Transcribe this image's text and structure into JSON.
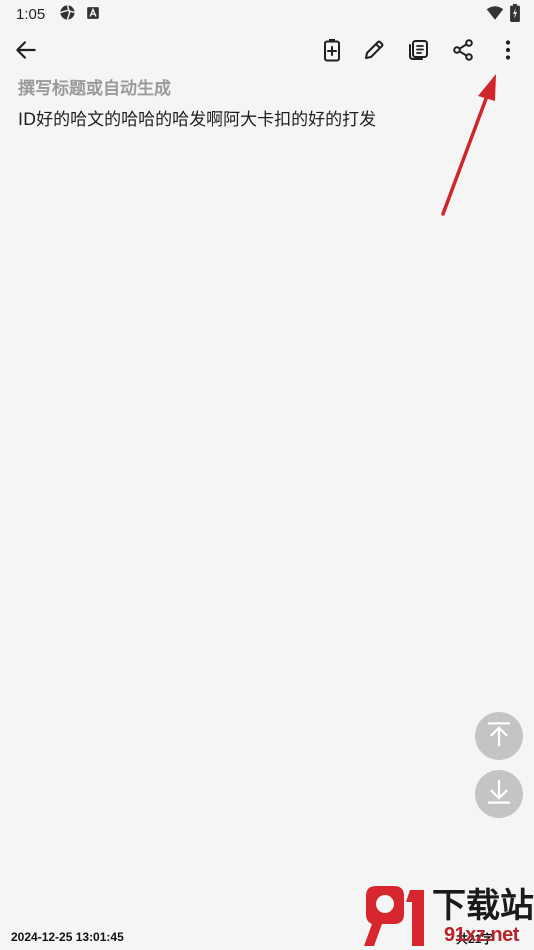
{
  "status_bar": {
    "time": "1:05"
  },
  "toolbar": {
    "icons": [
      "back-arrow-icon",
      "battery-plus-icon",
      "pencil-icon",
      "copy-icon",
      "share-icon",
      "more-vertical-icon"
    ]
  },
  "editor": {
    "title_placeholder": "撰写标题或自动生成",
    "body_text": "ID好的哈文的哈哈的哈发啊阿大卡扣的好的打发"
  },
  "footer": {
    "timestamp": "2024-12-25 13:01:45",
    "word_count": "共21字"
  },
  "watermark": {
    "brand": "下载站",
    "domain": "91xz.net",
    "logo_number": "91"
  },
  "colors": {
    "background": "#f5f5f5",
    "annotation_arrow": "#d0262b",
    "fab": "#c4c4c4",
    "placeholder": "#9a9a9a"
  }
}
